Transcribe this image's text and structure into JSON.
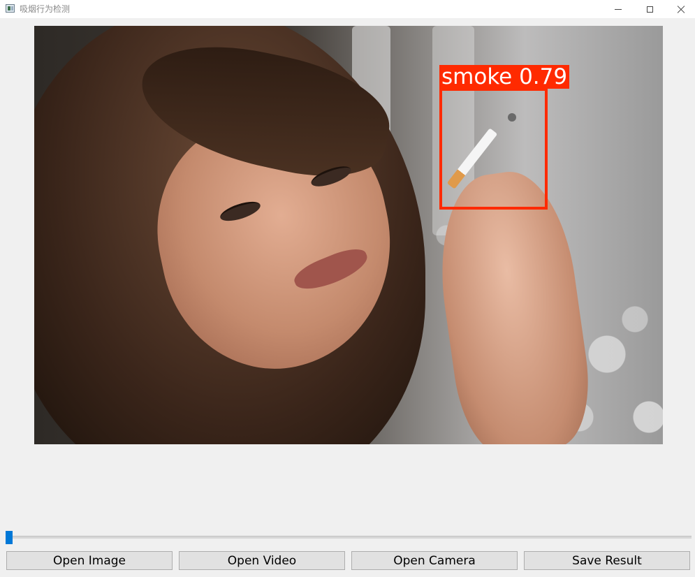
{
  "window": {
    "title": "吸烟行为检测",
    "icon": "app-window-icon",
    "controls": [
      "minimize-icon",
      "maximize-icon",
      "close-icon"
    ]
  },
  "detection": {
    "label": "smoke 0.79",
    "class": "smoke",
    "confidence": 0.79,
    "color": "#ff2a00"
  },
  "progress": {
    "value_fraction": 0.0,
    "accent": "#0078d7"
  },
  "buttons": {
    "open_image": "Open Image",
    "open_video": "Open Video",
    "open_camera": "Open Camera",
    "save_result": "Save Result"
  }
}
